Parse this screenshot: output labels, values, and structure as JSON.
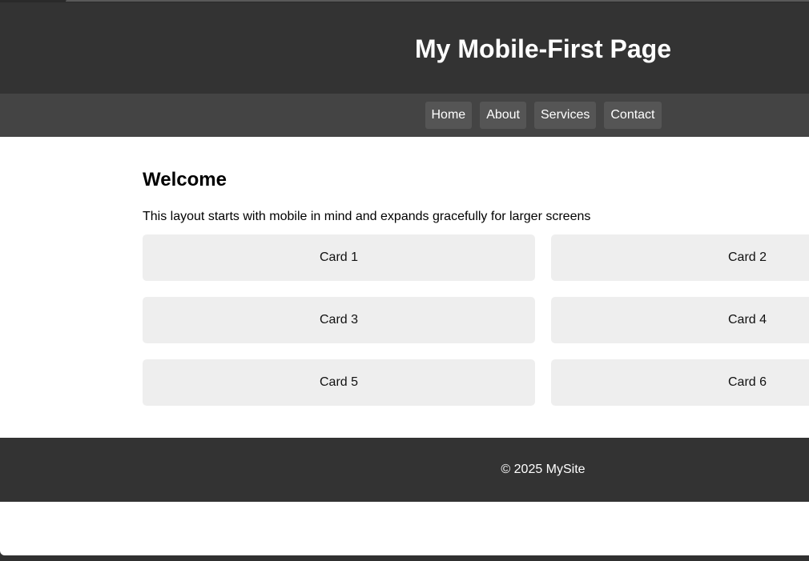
{
  "header": {
    "title": "My Mobile-First Page"
  },
  "nav": {
    "items": [
      {
        "label": "Home"
      },
      {
        "label": "About"
      },
      {
        "label": "Services"
      },
      {
        "label": "Contact"
      }
    ]
  },
  "main": {
    "heading": "Welcome",
    "intro": "This layout starts with mobile in mind and expands gracefully for larger screens",
    "cards": [
      {
        "label": "Card 1"
      },
      {
        "label": "Card 2"
      },
      {
        "label": "Card 3"
      },
      {
        "label": "Card 4"
      },
      {
        "label": "Card 5"
      },
      {
        "label": "Card 6"
      }
    ]
  },
  "footer": {
    "text": "© 2025 MySite"
  },
  "colors": {
    "header_bg": "#333333",
    "nav_bg": "#444444",
    "nav_link_bg": "#555555",
    "card_bg": "#eeeeee",
    "page_bg": "#ffffff"
  }
}
